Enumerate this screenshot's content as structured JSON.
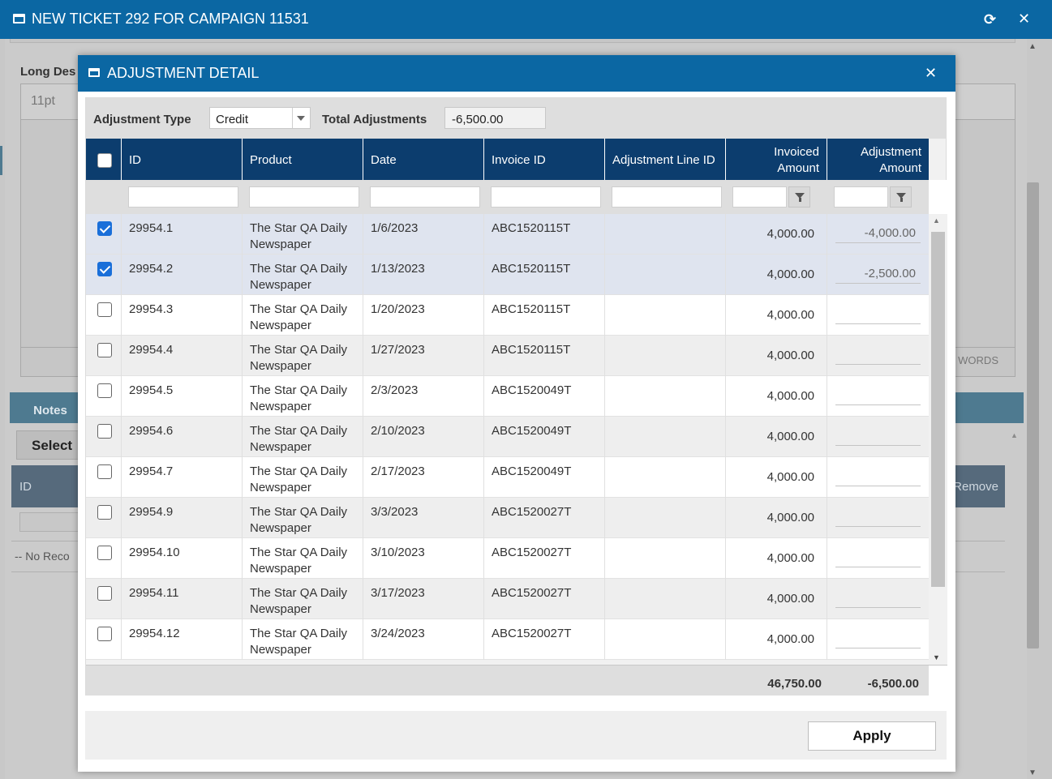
{
  "background_window": {
    "title": "NEW TICKET 292 FOR CAMPAIGN 11531",
    "refresh_glyph": "⟳",
    "close_glyph": "✕",
    "long_desc_label": "Long Des",
    "font_size_value": "11pt",
    "words_label": "WORDS",
    "notes_tab": "Notes",
    "select_button": "Select",
    "grid_id_header": "ID",
    "grid_remove_header": "Remove",
    "no_records": "-- No Reco"
  },
  "modal": {
    "title": "ADJUSTMENT DETAIL",
    "close_glyph": "✕",
    "adjustment_type_label": "Adjustment Type",
    "adjustment_type_value": "Credit",
    "total_adjustments_label": "Total Adjustments",
    "total_adjustments_value": "-6,500.00",
    "columns": {
      "id": "ID",
      "product": "Product",
      "date": "Date",
      "invoice_id": "Invoice ID",
      "adjustment_line_id": "Adjustment Line ID",
      "invoiced_amount_1": "Invoiced",
      "invoiced_amount_2": "Amount",
      "adjustment_amount_1": "Adjustment",
      "adjustment_amount_2": "Amount"
    },
    "rows": [
      {
        "checked": true,
        "id": "29954.1",
        "product_1": "The Star QA Daily",
        "product_2": "Newspaper",
        "date": "1/6/2023",
        "invoice_id": "ABC1520115T",
        "line_id": "",
        "invoiced": "4,000.00",
        "adjustment": "-4,000.00"
      },
      {
        "checked": true,
        "id": "29954.2",
        "product_1": "The Star QA Daily",
        "product_2": "Newspaper",
        "date": "1/13/2023",
        "invoice_id": "ABC1520115T",
        "line_id": "",
        "invoiced": "4,000.00",
        "adjustment": "-2,500.00"
      },
      {
        "checked": false,
        "id": "29954.3",
        "product_1": "The Star QA Daily",
        "product_2": "Newspaper",
        "date": "1/20/2023",
        "invoice_id": "ABC1520115T",
        "line_id": "",
        "invoiced": "4,000.00",
        "adjustment": ""
      },
      {
        "checked": false,
        "id": "29954.4",
        "product_1": "The Star QA Daily",
        "product_2": "Newspaper",
        "date": "1/27/2023",
        "invoice_id": "ABC1520115T",
        "line_id": "",
        "invoiced": "4,000.00",
        "adjustment": ""
      },
      {
        "checked": false,
        "id": "29954.5",
        "product_1": "The Star QA Daily",
        "product_2": "Newspaper",
        "date": "2/3/2023",
        "invoice_id": "ABC1520049T",
        "line_id": "",
        "invoiced": "4,000.00",
        "adjustment": ""
      },
      {
        "checked": false,
        "id": "29954.6",
        "product_1": "The Star QA Daily",
        "product_2": "Newspaper",
        "date": "2/10/2023",
        "invoice_id": "ABC1520049T",
        "line_id": "",
        "invoiced": "4,000.00",
        "adjustment": ""
      },
      {
        "checked": false,
        "id": "29954.7",
        "product_1": "The Star QA Daily",
        "product_2": "Newspaper",
        "date": "2/17/2023",
        "invoice_id": "ABC1520049T",
        "line_id": "",
        "invoiced": "4,000.00",
        "adjustment": ""
      },
      {
        "checked": false,
        "id": "29954.9",
        "product_1": "The Star QA Daily",
        "product_2": "Newspaper",
        "date": "3/3/2023",
        "invoice_id": "ABC1520027T",
        "line_id": "",
        "invoiced": "4,000.00",
        "adjustment": ""
      },
      {
        "checked": false,
        "id": "29954.10",
        "product_1": "The Star QA Daily",
        "product_2": "Newspaper",
        "date": "3/10/2023",
        "invoice_id": "ABC1520027T",
        "line_id": "",
        "invoiced": "4,000.00",
        "adjustment": ""
      },
      {
        "checked": false,
        "id": "29954.11",
        "product_1": "The Star QA Daily",
        "product_2": "Newspaper",
        "date": "3/17/2023",
        "invoice_id": "ABC1520027T",
        "line_id": "",
        "invoiced": "4,000.00",
        "adjustment": ""
      },
      {
        "checked": false,
        "id": "29954.12",
        "product_1": "The Star QA Daily",
        "product_2": "Newspaper",
        "date": "3/24/2023",
        "invoice_id": "ABC1520027T",
        "line_id": "",
        "invoiced": "4,000.00",
        "adjustment": ""
      }
    ],
    "totals": {
      "invoiced": "46,750.00",
      "adjustment": "-6,500.00"
    },
    "apply_button": "Apply"
  },
  "colors": {
    "title_bar": "#0b67a3",
    "grid_header": "#0c3d6e",
    "selected_row": "#dfe4ef",
    "checkbox_checked": "#1a6fd9"
  }
}
